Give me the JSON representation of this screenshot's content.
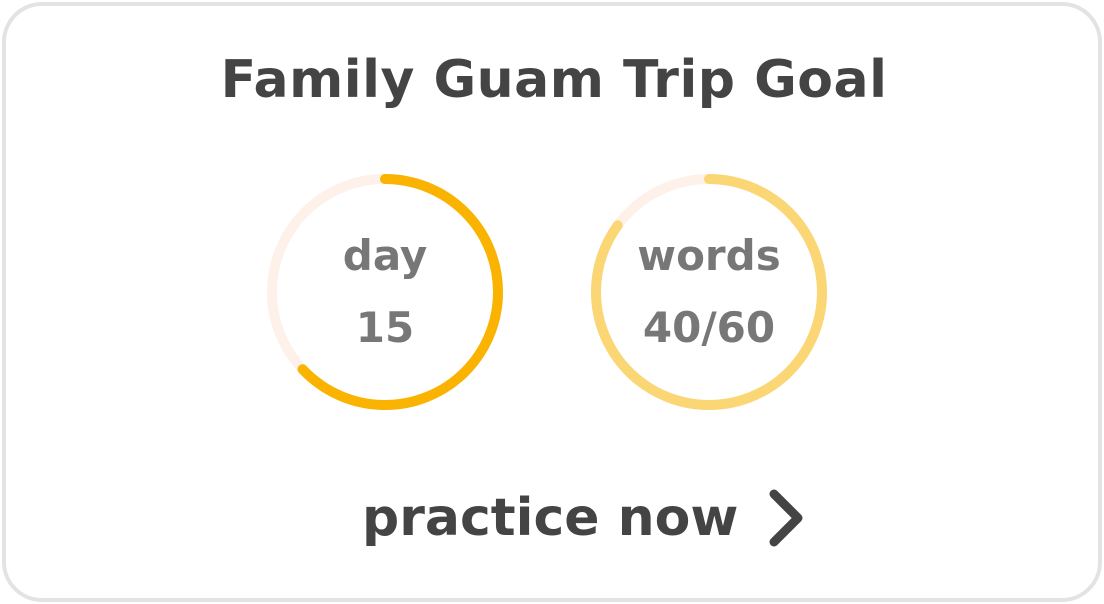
{
  "card": {
    "title": "Family Guam Trip Goal"
  },
  "rings": {
    "day": {
      "label": "day",
      "value": "15",
      "progress": 0.63,
      "color": "#F9B300",
      "track_color": "#FDF1EA"
    },
    "words": {
      "label": "words",
      "value": "40/60",
      "progress": 0.85,
      "color": "#FBD675",
      "track_color": "#FDF1EA"
    }
  },
  "cta": {
    "label": "practice now",
    "icon": "chevron-right-icon"
  }
}
